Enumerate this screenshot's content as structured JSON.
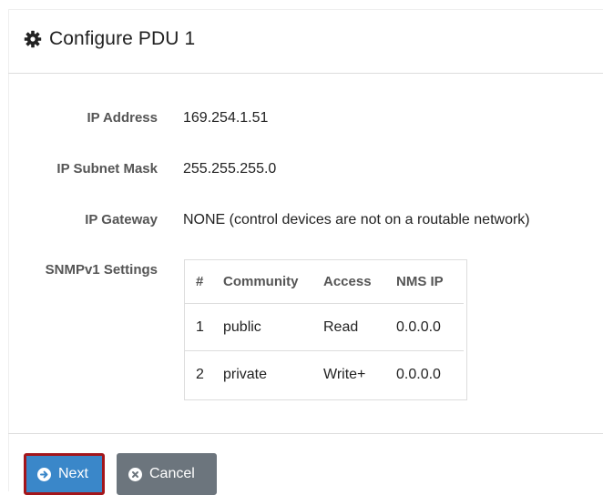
{
  "dialog": {
    "title": "Configure PDU 1",
    "title_icon": "gear-icon"
  },
  "fields": {
    "ip_address_label": "IP Address",
    "ip_address_value": "169.254.1.51",
    "subnet_label": "IP Subnet Mask",
    "subnet_value": "255.255.255.0",
    "gateway_label": "IP Gateway",
    "gateway_value": "NONE (control devices are not on a routable network)",
    "snmp_label": "SNMPv1 Settings"
  },
  "snmp_table": {
    "headers": [
      "#",
      "Community",
      "Access",
      "NMS IP"
    ],
    "rows": [
      [
        "1",
        "public",
        "Read",
        "0.0.0.0"
      ],
      [
        "2",
        "private",
        "Write+",
        "0.0.0.0"
      ]
    ]
  },
  "buttons": {
    "next_label": "Next",
    "next_icon": "arrow-right-circle-icon",
    "cancel_label": "Cancel",
    "cancel_icon": "x-circle-icon"
  },
  "colors": {
    "primary": "#3a87c9",
    "secondary": "#6c757d",
    "focus_border": "#a3161b"
  }
}
